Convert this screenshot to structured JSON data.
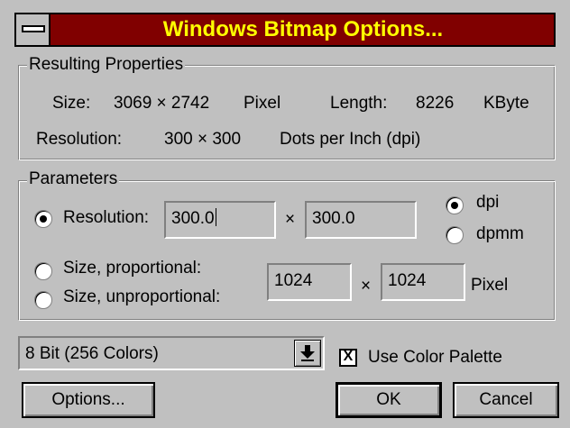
{
  "window": {
    "title": "Windows Bitmap Options..."
  },
  "resulting": {
    "legend": "Resulting Properties",
    "size_label": "Size:",
    "size_value": "3069 × 2742",
    "size_unit": "Pixel",
    "length_label": "Length:",
    "length_value": "8226",
    "length_unit": "KByte",
    "resolution_label": "Resolution:",
    "resolution_value": "300 × 300",
    "resolution_unit": "Dots per Inch (dpi)"
  },
  "parameters": {
    "legend": "Parameters",
    "mode_resolution_label": "Resolution:",
    "mode_size_prop_label": "Size, proportional:",
    "mode_size_unprop_label": "Size, unproportional:",
    "res_x": "300.0",
    "res_y": "300.0",
    "times": "×",
    "unit_dpi_label": "dpi",
    "unit_dpmm_label": "dpmm",
    "size_x": "1024",
    "size_y": "1024",
    "size_unit": "Pixel",
    "selected_mode": "resolution",
    "selected_unit": "dpi"
  },
  "color_depth": {
    "selected": "8 Bit (256 Colors)"
  },
  "use_palette": {
    "label": "Use Color Palette",
    "checked": true,
    "mark": "X"
  },
  "buttons": {
    "options": "Options...",
    "ok": "OK",
    "cancel": "Cancel"
  },
  "icons": {
    "system_menu": "system-menu-icon",
    "dropdown": "dropdown-arrow-icon"
  }
}
